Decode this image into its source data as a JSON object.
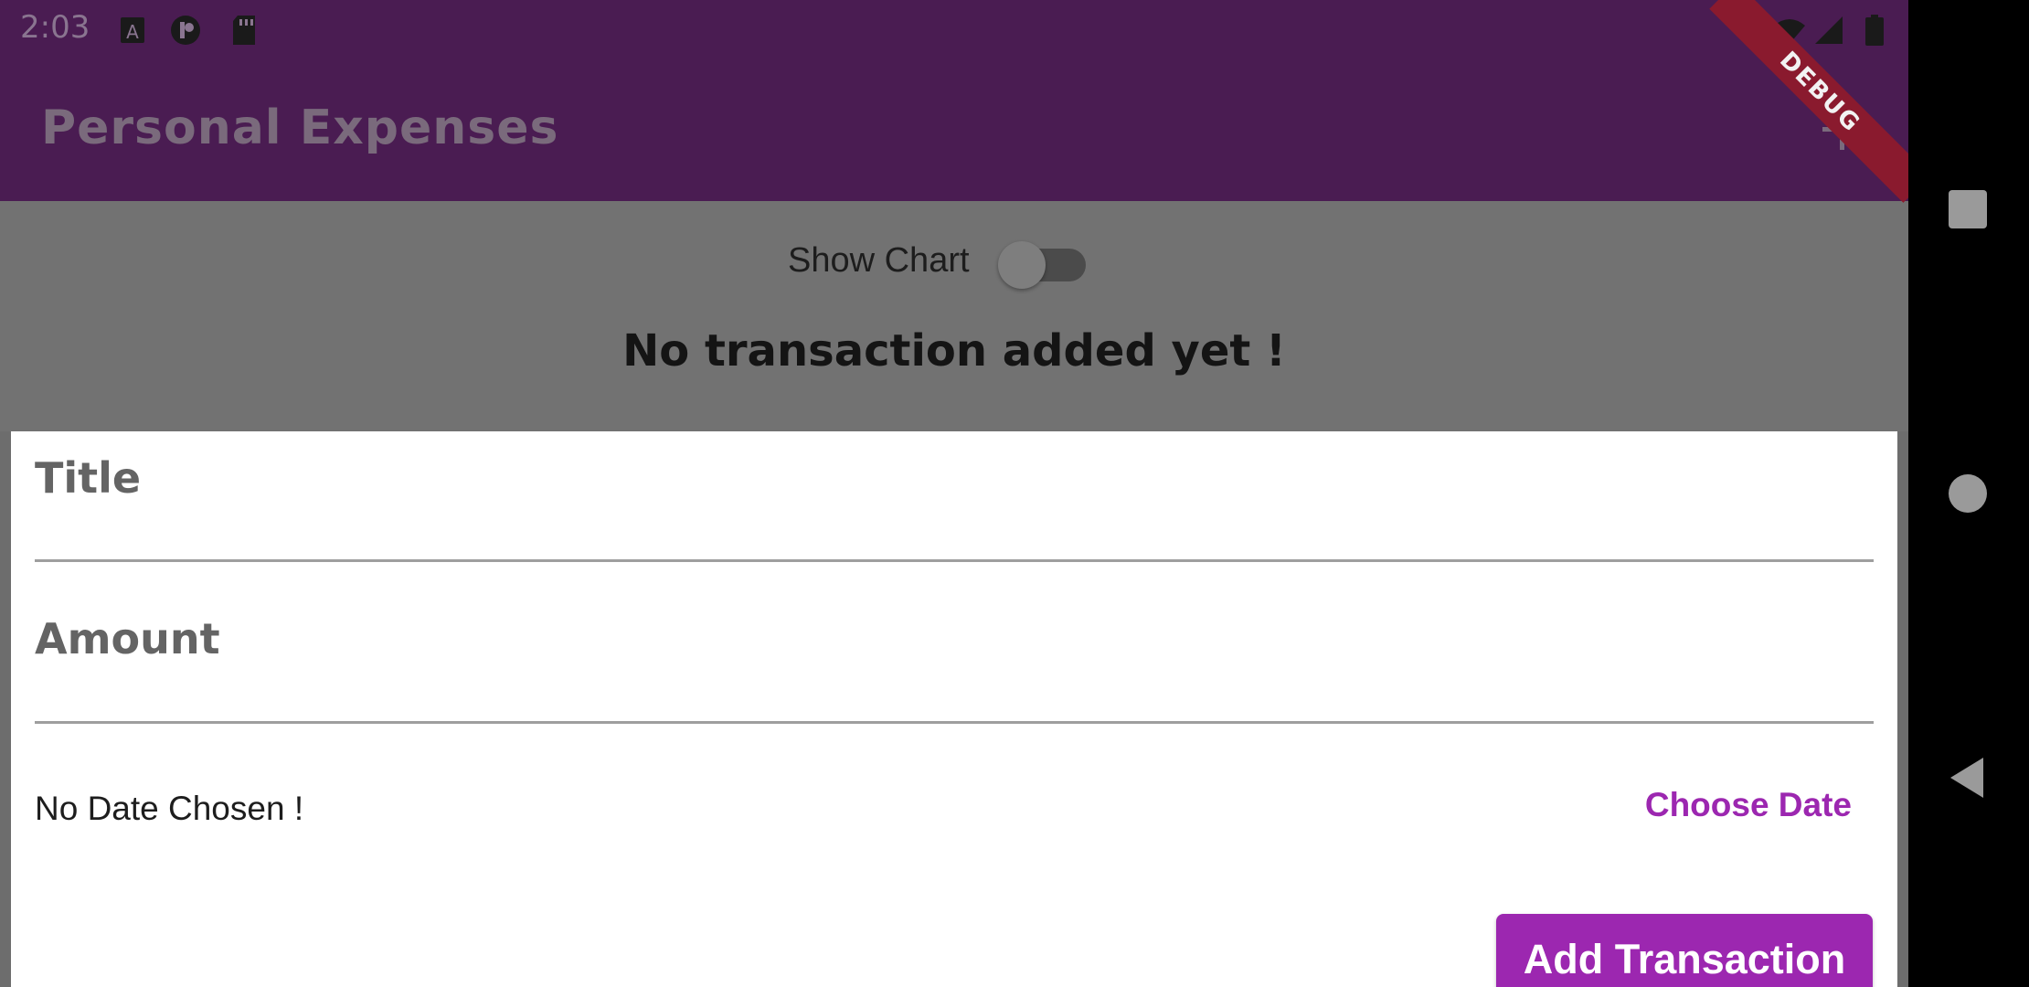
{
  "status_bar": {
    "time": "2:03",
    "icons": [
      "accessibility-icon",
      "app-notification-icon",
      "sd-card-icon",
      "wifi-icon",
      "signal-icon",
      "battery-icon"
    ]
  },
  "app_bar": {
    "title": "Personal Expenses",
    "add_icon": "plus-icon",
    "background_color": "#4a1c52"
  },
  "debug_banner": {
    "text": "DEBUG"
  },
  "toggle": {
    "label": "Show Chart",
    "state": false
  },
  "empty_message": "No transaction added yet !",
  "form": {
    "title_label": "Title",
    "title_value": "",
    "amount_label": "Amount",
    "amount_value": "",
    "date_text": "No Date Chosen !",
    "choose_date_label": "Choose Date",
    "submit_label": "Add Transaction",
    "accent_color": "#9c27b0"
  },
  "nav_bar": {
    "buttons": [
      "recent-apps-icon",
      "home-icon",
      "back-icon"
    ]
  }
}
